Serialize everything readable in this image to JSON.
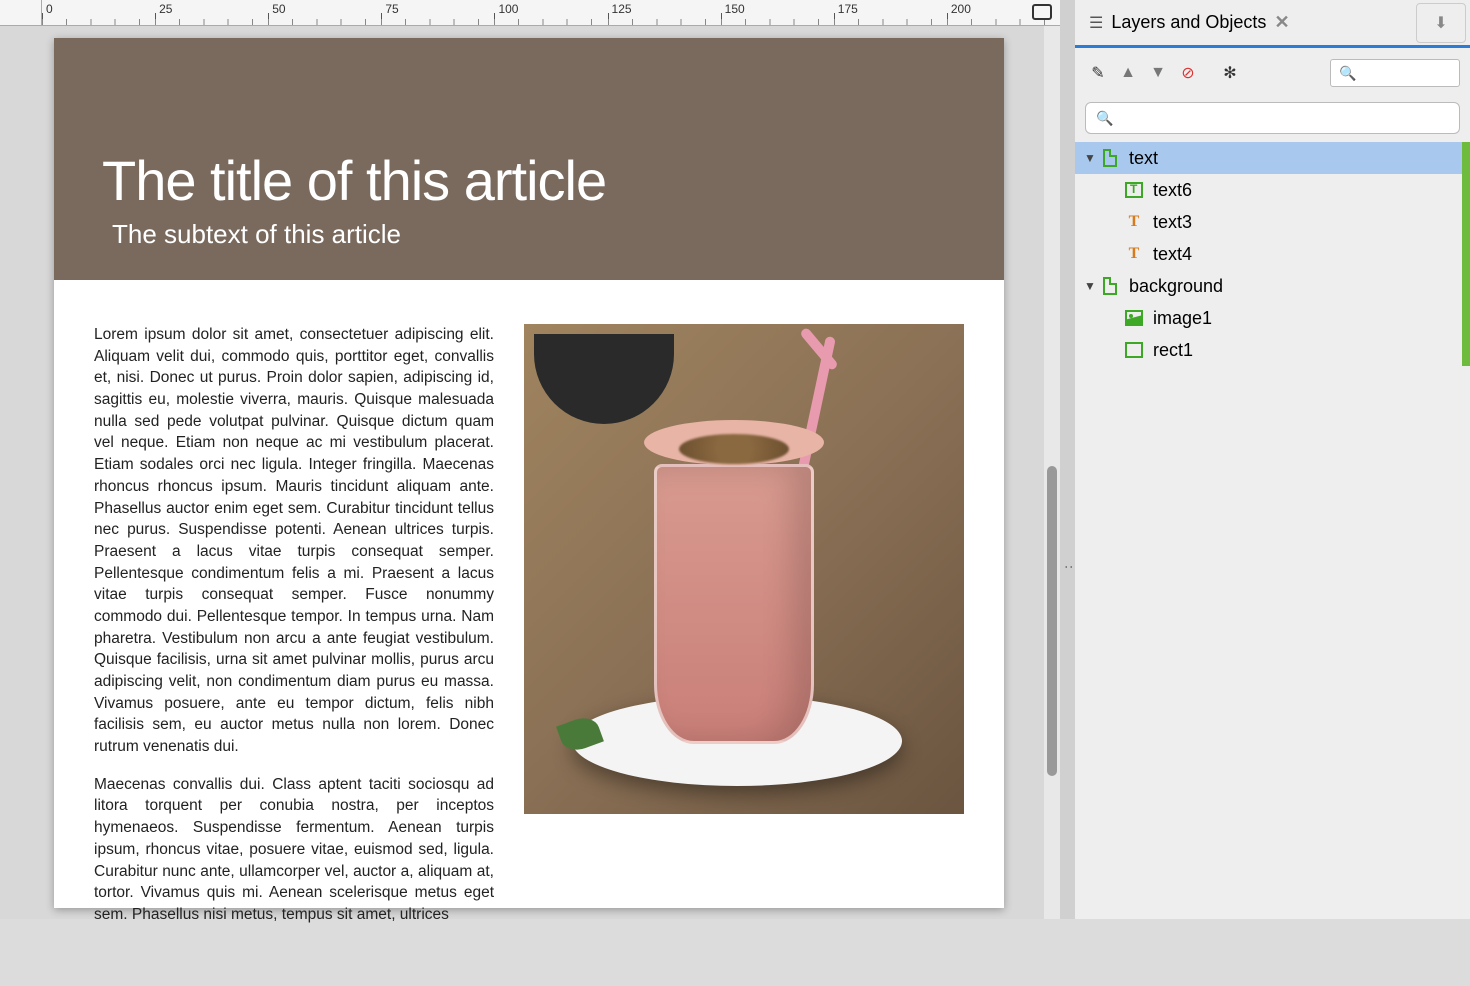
{
  "ruler": {
    "marks": [
      "0",
      "25",
      "50",
      "75",
      "100",
      "125",
      "150",
      "175",
      "200"
    ]
  },
  "document": {
    "title": "The title of this article",
    "subtitle": "The subtext of this article",
    "paragraph1": "Lorem ipsum dolor sit amet, consectetuer adipiscing elit. Aliquam velit dui, commodo quis, porttitor eget, convallis et, nisi. Donec ut purus. Proin dolor sapien, adipiscing id, sagittis eu, molestie viverra, mauris. Quisque malesuada nulla sed pede volutpat pulvinar. Quisque dictum quam vel neque. Etiam non neque ac mi vestibulum placerat. Etiam sodales orci nec ligula. Integer fringilla. Maecenas rhoncus rhoncus ipsum. Mauris tincidunt aliquam ante. Phasellus auctor enim eget sem. Curabitur tincidunt tellus nec purus. Suspendisse potenti. Aenean ultrices turpis. Praesent a lacus vitae turpis consequat semper. Pellentesque condimentum felis a mi. Praesent a lacus vitae turpis consequat semper. Fusce nonummy commodo dui. Pellentesque tempor. In tempus urna. Nam pharetra. Vestibulum non arcu a ante feugiat vestibulum. Quisque facilisis, urna sit amet pulvinar mollis, purus arcu adipiscing velit, non condimentum diam purus eu massa. Vivamus posuere, ante eu tempor dictum, felis nibh facilisis sem, eu auctor metus nulla non lorem. Donec rutrum venenatis dui.",
    "paragraph2": "Maecenas convallis dui. Class aptent taciti sociosqu ad litora torquent per conubia nostra, per inceptos hymenaeos. Suspendisse fermentum. Aenean turpis ipsum, rhoncus vitae, posuere vitae, euismod sed, ligula. Curabitur nunc ante, ullamcorper vel, auctor a, aliquam at, tortor. Vivamus quis mi. Aenean scelerisque metus eget sem. Phasellus nisi metus, tempus sit amet, ultrices"
  },
  "panel": {
    "title": "Layers and Objects",
    "toolbar_search_placeholder": "",
    "filter_placeholder": "",
    "items": [
      {
        "label": "text",
        "type": "layer",
        "indent": 0,
        "expanded": true,
        "selected": true
      },
      {
        "label": "text6",
        "type": "textbox",
        "indent": 1
      },
      {
        "label": "text3",
        "type": "text",
        "indent": 1
      },
      {
        "label": "text4",
        "type": "text",
        "indent": 1
      },
      {
        "label": "background",
        "type": "layer",
        "indent": 0,
        "expanded": true
      },
      {
        "label": "image1",
        "type": "image",
        "indent": 1
      },
      {
        "label": "rect1",
        "type": "rect",
        "indent": 1
      }
    ]
  }
}
